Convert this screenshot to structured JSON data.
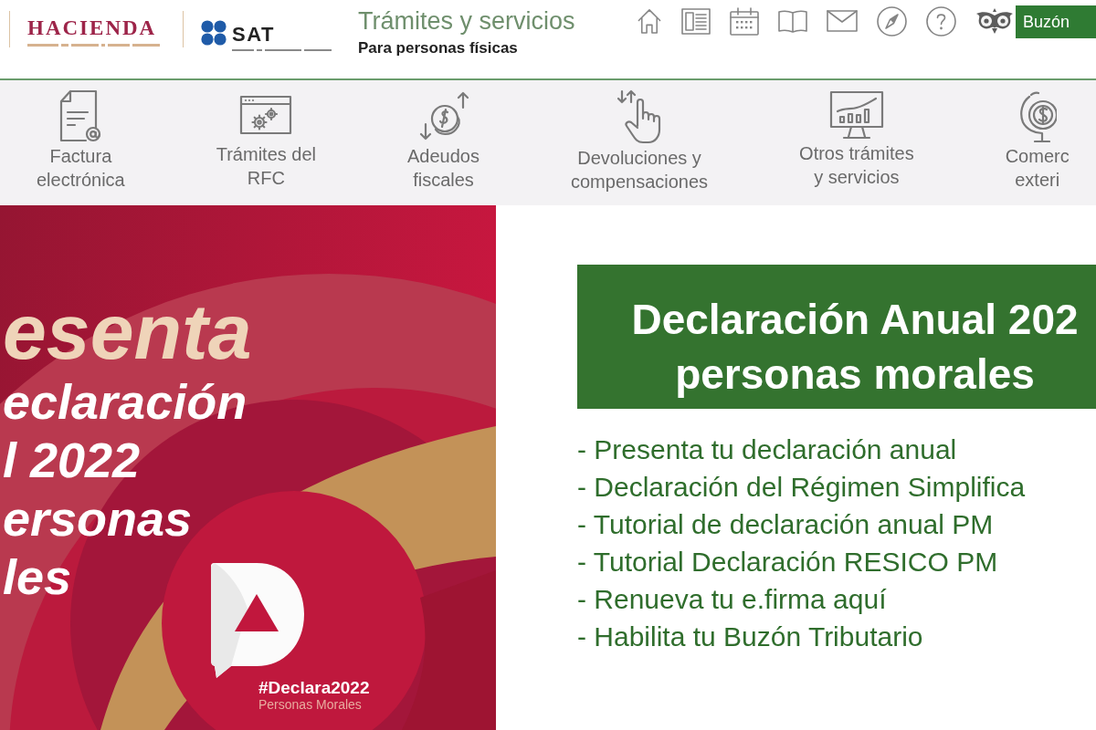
{
  "header": {
    "hacienda_logo": {
      "wordmark": "HACIENDA"
    },
    "sat_logo": {
      "wordmark": "SAT"
    },
    "title": "Trámites y servicios",
    "subtitle": "Para personas físicas",
    "mailbox_button": "Buzón"
  },
  "categories": [
    {
      "label_lines": [
        "Factura",
        "electrónica"
      ]
    },
    {
      "label_lines": [
        "Trámites del",
        "RFC"
      ]
    },
    {
      "label_lines": [
        "Adeudos",
        "fiscales"
      ]
    },
    {
      "label_lines": [
        "Devoluciones y",
        "compensaciones"
      ]
    },
    {
      "label_lines": [
        "Otros trámites",
        "y servicios"
      ]
    },
    {
      "label_lines": [
        "Comerc",
        "exteri"
      ]
    }
  ],
  "banner": {
    "headline": "esenta",
    "lines": [
      "eclaración",
      "l 2022",
      "ersonas",
      "les"
    ],
    "hashtag": "#Declara2022",
    "tagline": "Personas Morales"
  },
  "panel": {
    "heading_lines": [
      "Declaración Anual 202",
      "personas morales"
    ],
    "links": [
      "- Presenta tu declaración anual",
      "- Declaración del Régimen Simplifica",
      "- Tutorial de declaración anual PM",
      "- Tutorial Declaración RESICO PM",
      "- Renueva tu e.firma aquí",
      "- Habilita tu Buzón Tributario"
    ]
  }
}
